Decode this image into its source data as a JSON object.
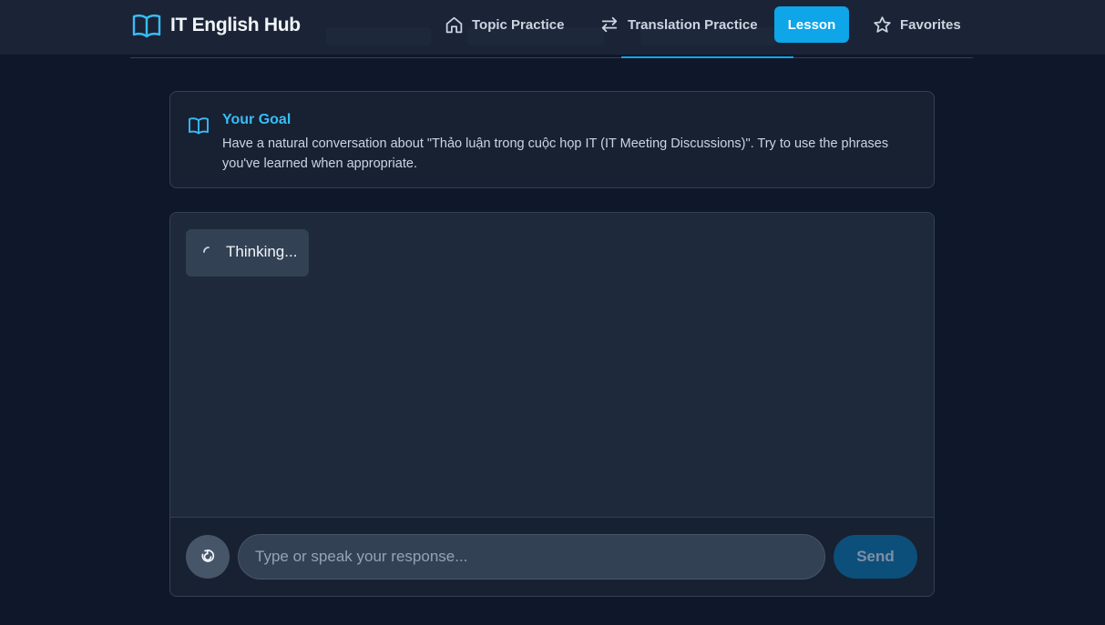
{
  "app": {
    "title": "IT English Hub",
    "brand_icon": "open-book-icon",
    "accent_color": "#0ea5e9"
  },
  "nav": {
    "items": [
      {
        "label": "Topic Practice",
        "icon": "home-icon"
      },
      {
        "label": "Translation Practice",
        "icon": "arrows-swap-icon"
      },
      {
        "label": "Lesson",
        "icon": "",
        "active": true
      },
      {
        "label": "Favorites",
        "icon": "star-icon"
      }
    ]
  },
  "goal": {
    "title": "Your Goal",
    "icon": "open-book-icon",
    "text": "Have a natural conversation about \"Thảo luận trong cuộc họp IT (IT Meeting Discussions)\". Try to use the phrases you've learned when appropriate."
  },
  "chat": {
    "status_text": "Thinking...",
    "status_icon": "spinner-icon",
    "input": {
      "placeholder": "Type or speak your response...",
      "value": ""
    },
    "mic_icon": "microphone-icon",
    "send_label": "Send"
  }
}
